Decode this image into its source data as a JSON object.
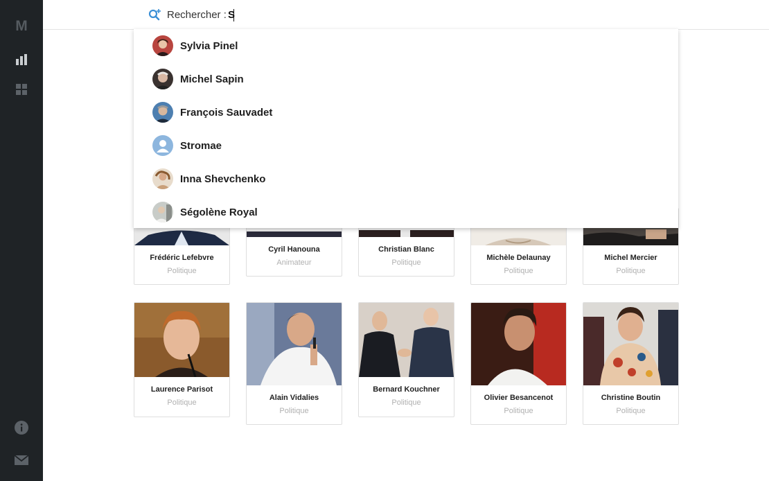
{
  "sidebar": {
    "logo": "M",
    "icons": [
      "bar-chart-icon",
      "grid-icon",
      "info-icon",
      "mail-icon"
    ]
  },
  "search": {
    "label": "Rechercher :",
    "value": "S"
  },
  "suggestions": [
    {
      "name": "Sylvia Pinel"
    },
    {
      "name": "Michel Sapin"
    },
    {
      "name": "François Sauvadet"
    },
    {
      "name": "Stromae"
    },
    {
      "name": "Inna Shevchenko"
    },
    {
      "name": "Ségolène Royal"
    }
  ],
  "cards_row1": [
    {
      "name": "Frédéric Lefebvre",
      "role": "Politique"
    },
    {
      "name": "Cyril Hanouna",
      "role": "Animateur"
    },
    {
      "name": "Christian Blanc",
      "role": "Politique"
    },
    {
      "name": "Michèle Delaunay",
      "role": "Politique"
    },
    {
      "name": "Michel Mercier",
      "role": "Politique"
    }
  ],
  "cards_row2": [
    {
      "name": "Laurence Parisot",
      "role": "Politique"
    },
    {
      "name": "Alain Vidalies",
      "role": "Politique"
    },
    {
      "name": "Bernard Kouchner",
      "role": "Politique"
    },
    {
      "name": "Olivier Besancenot",
      "role": "Politique"
    },
    {
      "name": "Christine Boutin",
      "role": "Politique"
    }
  ],
  "colors": {
    "sidebar_bg": "#1f2326",
    "sidebar_icon": "#5c6268",
    "sidebar_icon_active": "#c9cdd0",
    "accent": "#3a8fd6",
    "role_text": "#b0b0b0"
  }
}
